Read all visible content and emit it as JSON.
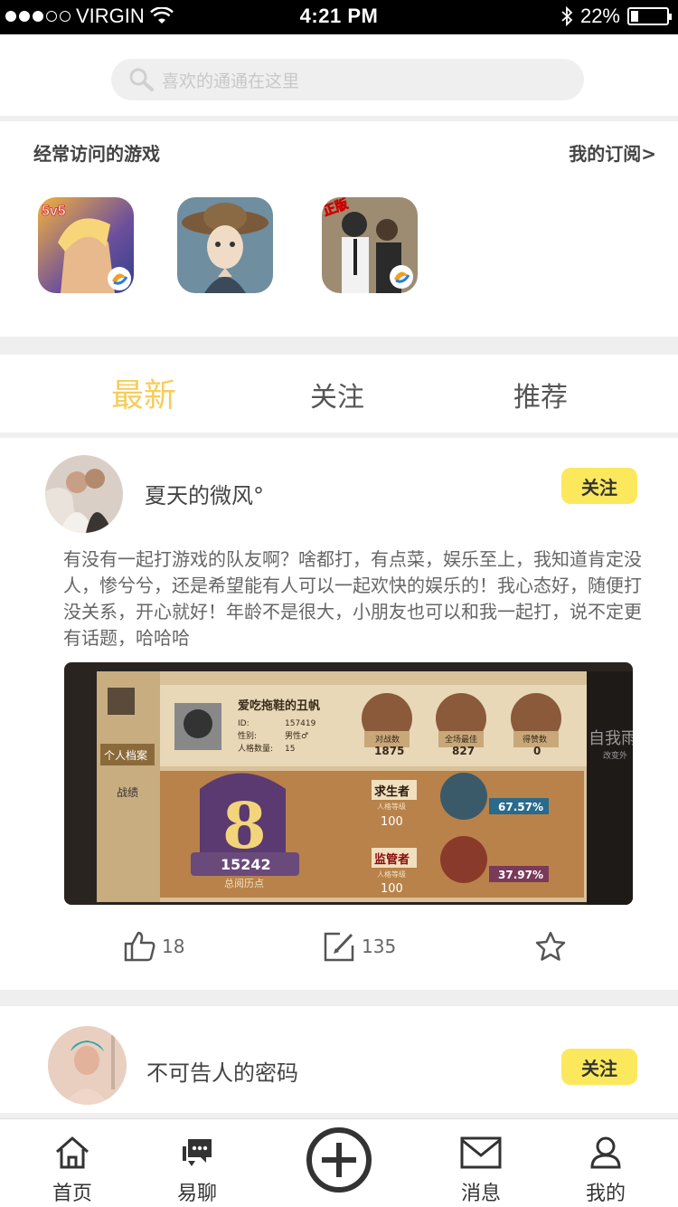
{
  "status": {
    "carrier": "VIRGIN",
    "time": "4:21 PM",
    "battery": "22%",
    "battery_level": 0.22,
    "signal_bars": 3
  },
  "search": {
    "placeholder": "喜欢的通通在这里"
  },
  "frequent": {
    "title": "经常访问的游戏",
    "subscribe_link": "我的订阅>",
    "games": [
      {
        "name": "game-icon-1",
        "badge": "5v5"
      },
      {
        "name": "game-icon-2"
      },
      {
        "name": "game-icon-3",
        "badge": "正版"
      }
    ]
  },
  "tabs": [
    {
      "label": "最新",
      "active": true
    },
    {
      "label": "关注",
      "active": false
    },
    {
      "label": "推荐",
      "active": false
    }
  ],
  "posts": [
    {
      "username": "夏天的微风°",
      "follow_label": "关注",
      "text": "有没有一起打游戏的队友啊？啥都打，有点菜，娱乐至上，我知道肯定没人，惨兮兮，还是希望能有人可以一起欢快的娱乐的！我心态好，随便打没关系，开心就好！年龄不是很大，小朋友也可以和我一起打，说不定更有话题，哈哈哈",
      "likes": "18",
      "comments": "135",
      "image": {
        "player_name": "爱吃拖鞋的丑帆",
        "id_label": "ID:",
        "id_value": "157419",
        "gender_label": "性别:",
        "gender_value": "男性♂",
        "count_label": "人格数量:",
        "count_value": "15",
        "side_menu": [
          "个人档案",
          "战绩"
        ],
        "badges": [
          {
            "label": "对战数",
            "value": "1875"
          },
          {
            "label": "全场最佳",
            "value": "827"
          },
          {
            "label": "得赞数",
            "value": "0"
          }
        ],
        "big_number": "8",
        "score": "15242",
        "score_label": "总阅历点",
        "roles": [
          {
            "role": "求生者",
            "sub": "人格等级",
            "level": "100",
            "pct": "67.57%"
          },
          {
            "role": "监管者",
            "sub": "人格等级",
            "level": "100",
            "pct": "37.97%"
          }
        ],
        "side_text": "自我雨",
        "side_subtext": "改变外"
      }
    },
    {
      "username": "不可告人的密码",
      "follow_label": "关注"
    }
  ],
  "nav": [
    {
      "label": "首页",
      "icon": "home-icon"
    },
    {
      "label": "易聊",
      "icon": "chat-icon"
    },
    {
      "label": "",
      "icon": "add-icon"
    },
    {
      "label": "消息",
      "icon": "mail-icon"
    },
    {
      "label": "我的",
      "icon": "profile-icon"
    }
  ],
  "colors": {
    "accent": "#f7cd5a",
    "follow_bg": "#fbe85d",
    "divider": "#efefef"
  }
}
